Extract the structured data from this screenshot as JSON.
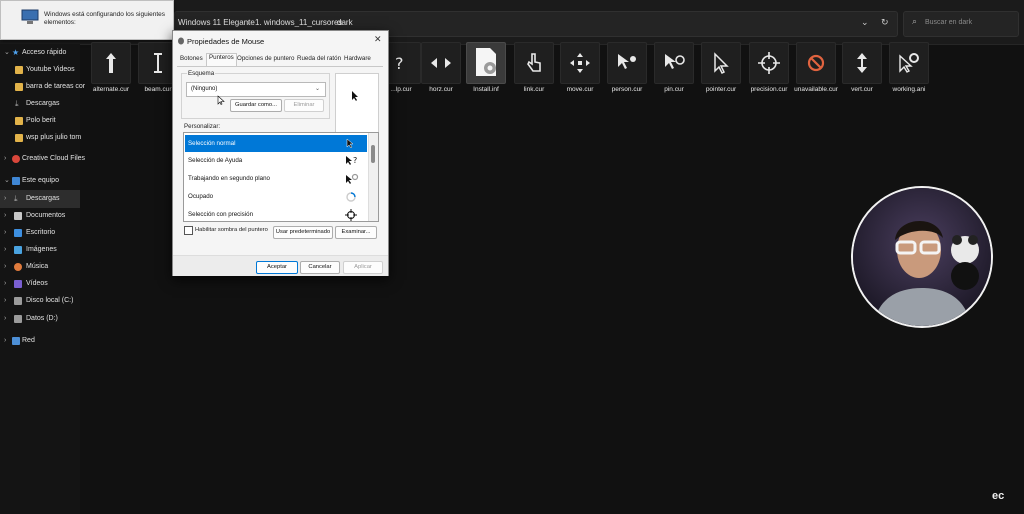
{
  "notification": {
    "text": "Windows está configurando los siguientes elementos:"
  },
  "explorer": {
    "breadcrumb": [
      "Windows 11 Elegante",
      "1. windows_11_cursores",
      "dark"
    ],
    "search_placeholder": "Buscar en dark"
  },
  "sidebar": {
    "items": [
      {
        "label": "Acceso rápido",
        "icon": "star-icon"
      },
      {
        "label": "Youtube Videos",
        "icon": "folder-icon"
      },
      {
        "label": "barra de tareas cor",
        "icon": "folder-icon"
      },
      {
        "label": "Descargas",
        "icon": "download-icon"
      },
      {
        "label": "Polo berit",
        "icon": "folder-icon"
      },
      {
        "label": "wsp plus julio tom",
        "icon": "folder-icon"
      },
      {
        "label": "Creative Cloud Files",
        "icon": "cloud-icon"
      },
      {
        "label": "Este equipo",
        "icon": "computer-icon"
      },
      {
        "label": "Descargas",
        "icon": "download-icon"
      },
      {
        "label": "Documentos",
        "icon": "document-icon"
      },
      {
        "label": "Escritorio",
        "icon": "desktop-icon"
      },
      {
        "label": "Imágenes",
        "icon": "image-icon"
      },
      {
        "label": "Música",
        "icon": "music-icon"
      },
      {
        "label": "Vídeos",
        "icon": "video-icon"
      },
      {
        "label": "Disco local (C:)",
        "icon": "drive-icon"
      },
      {
        "label": "Datos (D:)",
        "icon": "drive-icon"
      },
      {
        "label": "Red",
        "icon": "network-icon"
      }
    ]
  },
  "files": [
    {
      "name": "alternate.cur",
      "icon": "up-arrow-cursor-icon"
    },
    {
      "name": "beam.cur",
      "icon": "text-beam-cursor-icon"
    },
    {
      "name": "...lp.cur",
      "icon": "help-cursor-icon"
    },
    {
      "name": "horz.cur",
      "icon": "horizontal-resize-icon"
    },
    {
      "name": "Install.inf",
      "icon": "settings-file-icon"
    },
    {
      "name": "link.cur",
      "icon": "hand-cursor-icon"
    },
    {
      "name": "move.cur",
      "icon": "move-cursor-icon"
    },
    {
      "name": "person.cur",
      "icon": "person-cursor-icon"
    },
    {
      "name": "pin.cur",
      "icon": "pin-cursor-icon"
    },
    {
      "name": "pointer.cur",
      "icon": "pointer-cursor-icon"
    },
    {
      "name": "precision.cur",
      "icon": "crosshair-cursor-icon"
    },
    {
      "name": "unavailable.cur",
      "icon": "unavailable-cursor-icon"
    },
    {
      "name": "vert.cur",
      "icon": "vertical-resize-icon"
    },
    {
      "name": "working.ani",
      "icon": "working-cursor-icon"
    }
  ],
  "dialog": {
    "title": "Propiedades de Mouse",
    "tabs": [
      "Botones",
      "Punteros",
      "Opciones de puntero",
      "Rueda del ratón",
      "Hardware"
    ],
    "active_tab": "Punteros",
    "scheme_label": "Esquema",
    "scheme_value": "(Ninguno)",
    "save_as": "Guardar como...",
    "delete": "Eliminar",
    "customize_label": "Personalizar:",
    "list": [
      {
        "label": "Selección normal",
        "selected": true
      },
      {
        "label": "Selección de Ayuda"
      },
      {
        "label": "Trabajando en segundo plano"
      },
      {
        "label": "Ocupado"
      },
      {
        "label": "Selección con precisión"
      }
    ],
    "shadow_checkbox": "Habilitar sombra del puntero",
    "use_default": "Usar predeterminado",
    "browse": "Examinar...",
    "ok": "Aceptar",
    "cancel": "Cancelar",
    "apply": "Aplicar"
  },
  "watermark": "ec"
}
